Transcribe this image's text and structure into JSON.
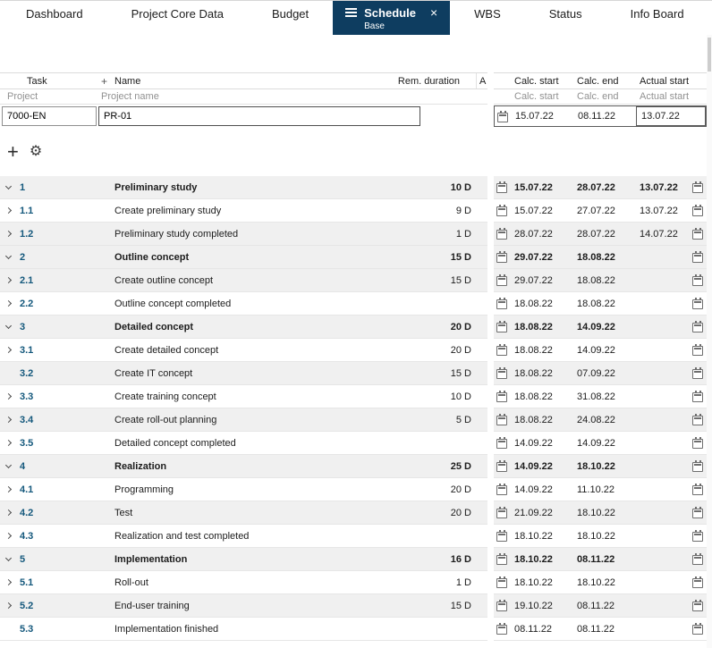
{
  "colors": {
    "accent": "#0e3d60",
    "task_number": "#14587c"
  },
  "tabs": [
    {
      "label": "Dashboard"
    },
    {
      "label": "Project Core Data"
    },
    {
      "label": "Budget"
    },
    {
      "label": "Schedule",
      "sublabel": "Base",
      "active": true,
      "close_icon": "×"
    },
    {
      "label": "WBS"
    },
    {
      "label": "Status"
    },
    {
      "label": "Info Board"
    }
  ],
  "header": {
    "task": "Task",
    "plus": "+",
    "name": "Name",
    "rem_duration": "Rem. duration",
    "truncated_col": "A",
    "project": "Project",
    "project_name": "Project name",
    "calc_start": "Calc. start",
    "calc_end": "Calc. end",
    "actual_start": "Actual start"
  },
  "project_row": {
    "id": "7000-EN",
    "name": "PR-01",
    "calc_start": "15.07.22",
    "calc_end": "08.11.22",
    "actual_start": "13.07.22"
  },
  "toolbar": {
    "add": "+",
    "settings": "⚙"
  },
  "rows": [
    {
      "num": "1",
      "name": "Preliminary study",
      "duration": "10 D",
      "calc_start": "15.07.22",
      "calc_end": "28.07.22",
      "actual_start": "13.07.22",
      "parent": true,
      "expand": "down"
    },
    {
      "num": "1.1",
      "name": "Create preliminary study",
      "duration": "9 D",
      "calc_start": "15.07.22",
      "calc_end": "27.07.22",
      "actual_start": "13.07.22",
      "expand": "right"
    },
    {
      "num": "1.2",
      "name": "Preliminary study completed",
      "duration": "1 D",
      "calc_start": "28.07.22",
      "calc_end": "28.07.22",
      "actual_start": "14.07.22",
      "expand": "right"
    },
    {
      "num": "2",
      "name": "Outline concept",
      "duration": "15 D",
      "calc_start": "29.07.22",
      "calc_end": "18.08.22",
      "actual_start": "",
      "parent": true,
      "expand": "down"
    },
    {
      "num": "2.1",
      "name": "Create outline concept",
      "duration": "15 D",
      "calc_start": "29.07.22",
      "calc_end": "18.08.22",
      "actual_start": "",
      "expand": "right"
    },
    {
      "num": "2.2",
      "name": "Outline concept completed",
      "duration": "",
      "calc_start": "18.08.22",
      "calc_end": "18.08.22",
      "actual_start": "",
      "expand": "right"
    },
    {
      "num": "3",
      "name": "Detailed concept",
      "duration": "20 D",
      "calc_start": "18.08.22",
      "calc_end": "14.09.22",
      "actual_start": "",
      "parent": true,
      "expand": "down"
    },
    {
      "num": "3.1",
      "name": "Create detailed concept",
      "duration": "20 D",
      "calc_start": "18.08.22",
      "calc_end": "14.09.22",
      "actual_start": "",
      "expand": "right"
    },
    {
      "num": "3.2",
      "name": "Create IT concept",
      "duration": "15 D",
      "calc_start": "18.08.22",
      "calc_end": "07.09.22",
      "actual_start": "",
      "expand": "none"
    },
    {
      "num": "3.3",
      "name": "Create training concept",
      "duration": "10 D",
      "calc_start": "18.08.22",
      "calc_end": "31.08.22",
      "actual_start": "",
      "expand": "right"
    },
    {
      "num": "3.4",
      "name": "Create roll-out planning",
      "duration": "5 D",
      "calc_start": "18.08.22",
      "calc_end": "24.08.22",
      "actual_start": "",
      "expand": "right"
    },
    {
      "num": "3.5",
      "name": "Detailed concept completed",
      "duration": "",
      "calc_start": "14.09.22",
      "calc_end": "14.09.22",
      "actual_start": "",
      "expand": "right"
    },
    {
      "num": "4",
      "name": "Realization",
      "duration": "25 D",
      "calc_start": "14.09.22",
      "calc_end": "18.10.22",
      "actual_start": "",
      "parent": true,
      "expand": "down"
    },
    {
      "num": "4.1",
      "name": "Programming",
      "duration": "20 D",
      "calc_start": "14.09.22",
      "calc_end": "11.10.22",
      "actual_start": "",
      "expand": "right"
    },
    {
      "num": "4.2",
      "name": "Test",
      "duration": "20 D",
      "calc_start": "21.09.22",
      "calc_end": "18.10.22",
      "actual_start": "",
      "expand": "right"
    },
    {
      "num": "4.3",
      "name": "Realization and test completed",
      "duration": "",
      "calc_start": "18.10.22",
      "calc_end": "18.10.22",
      "actual_start": "",
      "expand": "right"
    },
    {
      "num": "5",
      "name": "Implementation",
      "duration": "16 D",
      "calc_start": "18.10.22",
      "calc_end": "08.11.22",
      "actual_start": "",
      "parent": true,
      "expand": "down"
    },
    {
      "num": "5.1",
      "name": "Roll-out",
      "duration": "1 D",
      "calc_start": "18.10.22",
      "calc_end": "18.10.22",
      "actual_start": "",
      "expand": "right"
    },
    {
      "num": "5.2",
      "name": "End-user training",
      "duration": "15 D",
      "calc_start": "19.10.22",
      "calc_end": "08.11.22",
      "actual_start": "",
      "expand": "right"
    },
    {
      "num": "5.3",
      "name": "Implementation finished",
      "duration": "",
      "calc_start": "08.11.22",
      "calc_end": "08.11.22",
      "actual_start": "",
      "expand": "none"
    }
  ]
}
